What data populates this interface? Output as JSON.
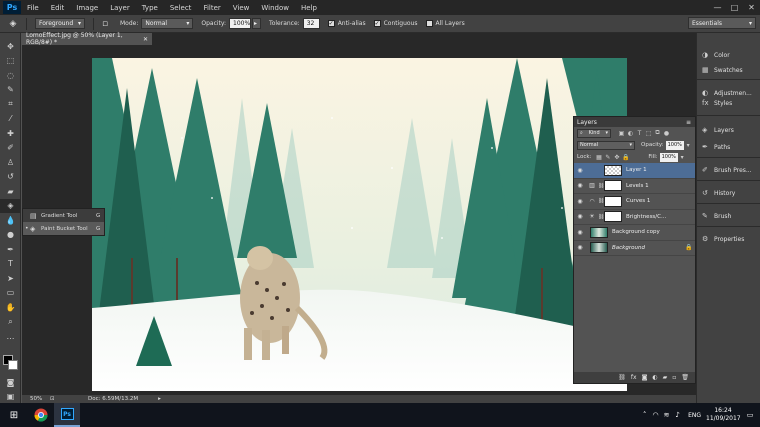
{
  "app": {
    "logo": "Ps"
  },
  "menu": [
    "File",
    "Edit",
    "Image",
    "Layer",
    "Type",
    "Select",
    "Filter",
    "View",
    "Window",
    "Help"
  ],
  "window_controls": [
    "minimize-icon",
    "maximize-icon",
    "close-icon"
  ],
  "options_bar": {
    "fill_source": "Foreground",
    "mode_label": "Mode:",
    "mode_value": "Normal",
    "opacity_label": "Opacity:",
    "opacity_value": "100%",
    "tolerance_label": "Tolerance:",
    "tolerance_value": "32",
    "anti_alias_label": "Anti-alias",
    "anti_alias_checked": true,
    "contiguous_label": "Contiguous",
    "contiguous_checked": true,
    "all_layers_label": "All Layers",
    "all_layers_checked": false
  },
  "workspace": "Essentials",
  "document": {
    "tab_title": "LomoEffect.jpg @ 50% (Layer 1, RGB/8#) *",
    "zoom": "50%",
    "doc_info": "Doc: 6.59M/13.2M"
  },
  "tool_flyout": [
    {
      "label": "Gradient Tool",
      "shortcut": "G",
      "selected": false
    },
    {
      "label": "Paint Bucket Tool",
      "shortcut": "G",
      "selected": true
    }
  ],
  "layers_panel": {
    "title": "Layers",
    "kind_label": "Kind",
    "blend_mode": "Normal",
    "opacity_label": "Opacity:",
    "opacity_value": "100%",
    "lock_label": "Lock:",
    "fill_label": "Fill:",
    "fill_value": "100%",
    "layers": [
      {
        "name": "Layer 1",
        "type": "pixel",
        "selected": true
      },
      {
        "name": "Levels 1",
        "type": "adjustment",
        "selected": false
      },
      {
        "name": "Curves 1",
        "type": "adjustment",
        "selected": false
      },
      {
        "name": "Brightness/C...",
        "type": "adjustment",
        "selected": false
      },
      {
        "name": "Background copy",
        "type": "image",
        "selected": false
      },
      {
        "name": "Background",
        "type": "image",
        "selected": false,
        "locked": true
      }
    ]
  },
  "mini_panels": [
    "Color",
    "Swatches",
    "Adjustmen...",
    "Styles",
    "Layers",
    "Paths",
    "Brush Pres...",
    "History",
    "Brush",
    "Properties"
  ],
  "taskbar": {
    "language": "ENG",
    "time": "16:24",
    "date": "11/09/2017"
  }
}
